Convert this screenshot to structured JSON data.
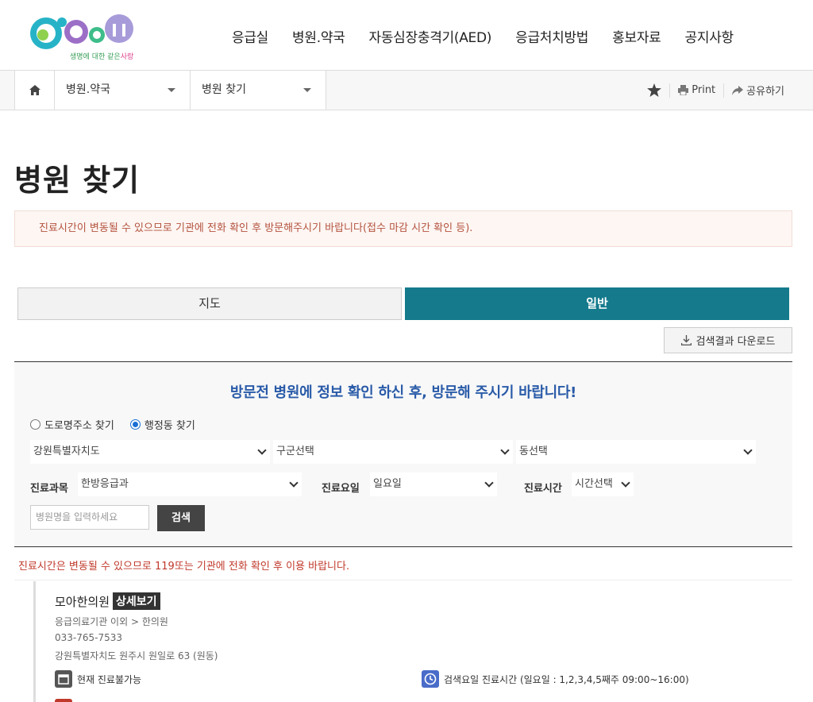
{
  "header": {
    "logo_text": "e·G·G·n",
    "logo_tagline_green": "생명에 대한 같은",
    "logo_tagline_pink": "사랑",
    "nav": [
      "응급실",
      "병원.약국",
      "자동심장충격기(AED)",
      "응급처치방법",
      "홍보자료",
      "공지사항"
    ]
  },
  "location": {
    "level1": "병원.약국",
    "level2": "병원 찾기",
    "print_label": "Print",
    "share_label": "공유하기"
  },
  "page": {
    "title": "병원 찾기",
    "notice": "진료시간이 변동될 수 있으므로 기관에 전화 확인 후 방문해주시기 바랍니다(접수 마감 시간 확인 등)."
  },
  "tabs": {
    "map": "지도",
    "general": "일반"
  },
  "download_label": "검색결과 다운로드",
  "search": {
    "headline": "방문전 병원에 정보 확인 하신 후, 방문해 주시기 바랍니다!",
    "radio_road": "도로명주소 찾기",
    "radio_admin": "행정동 찾기",
    "selected_radio": "행정동 찾기",
    "sido": "강원특별자치도",
    "gugun": "구군선택",
    "dong": "동선택",
    "dept_label": "진료과목",
    "dept_value": "한방응급과",
    "day_label": "진료요일",
    "day_value": "일요일",
    "time_label": "진료시간",
    "time_value": "시간선택",
    "name_placeholder": "병원명을 입력하세요",
    "search_button": "검색"
  },
  "warning": "진료시간은 변동될 수 있으므로 119또는 기관에 전화 확인 후 이용 바랍니다.",
  "results": [
    {
      "name": "모아한의원",
      "detail_label": "상세보기",
      "category": "응급의료기관 이외 > 한의원",
      "phone": "033-765-7533",
      "address": "강원특별자치도 원주시 원일로 63 (원동)",
      "status": "현재 진료불가능",
      "hours": "검색요일 진료시간 (일요일 : 1,2,3,4,5째주 09:00~16:00)"
    }
  ],
  "colors": {
    "tab_active": "#147a8c",
    "headline_blue": "#2a5ba8",
    "warning_red": "#c0392b",
    "notice_bg": "#fdf6f3"
  }
}
